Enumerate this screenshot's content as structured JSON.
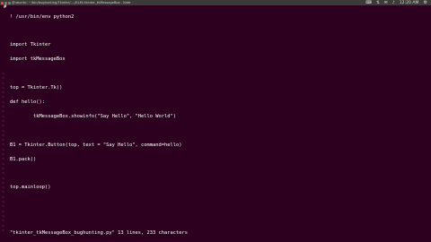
{
  "window": {
    "title": "@ubuntu: ~/bin/bughunting/Tkinter/..../KLM/ tkinter_tkMessageBox - Kate",
    "indicators": {
      "keyboard": "⌨",
      "network": "⇅",
      "mail": "✉",
      "volume": "♪",
      "clock": "12:20 AM",
      "settings": "⚙"
    }
  },
  "editor": {
    "lines": [
      "! /usr/bin/env python2",
      "",
      "import Tkinter",
      "import tkMessageBox",
      "",
      "top = Tkinter.Tk()",
      "def hello():",
      "        tkMessageBox.showinfo(\"Say Hello\", \"Hello World\")",
      "",
      "B1 = Tkinter.Button(top, text = \"Say Hello\", command=hello)",
      "B1.pack()",
      "",
      "top.mainloop()"
    ],
    "hash_prefix": "#",
    "tilde_char": "~",
    "status": "\"tkinter_tkMessageBox_bughunting.py\" 13 lines, 233 characters"
  }
}
